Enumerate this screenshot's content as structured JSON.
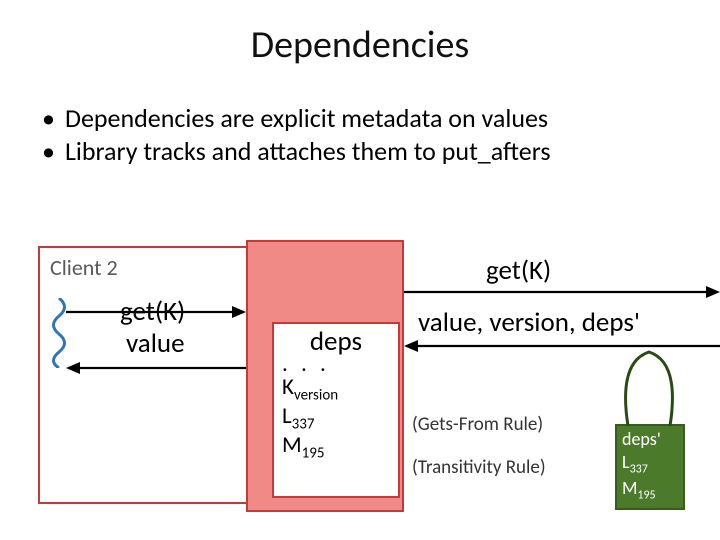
{
  "title": "Dependencies",
  "bullets": {
    "b1": "Dependencies are explicit metadata on values",
    "b2": "Library tracks and attaches them to put_afters"
  },
  "clientLabel": "Client 2",
  "innerGetK": "get(K)",
  "innerValue": "value",
  "deps": {
    "header": "deps",
    "ellipsis": ". . .",
    "kLabel": "K",
    "kSub": "version",
    "lLabel": "L",
    "lSub": "337",
    "mLabel": "M",
    "mSub": "195"
  },
  "getKTop": "get(K)",
  "vvd": "value, version, deps'",
  "rule1": "(Gets-From Rule)",
  "rule2": "(Transitivity Rule)",
  "depsPrime": {
    "header": "deps'",
    "lLabel": "L",
    "lSub": "337",
    "mLabel": "M",
    "mSub": "195"
  }
}
